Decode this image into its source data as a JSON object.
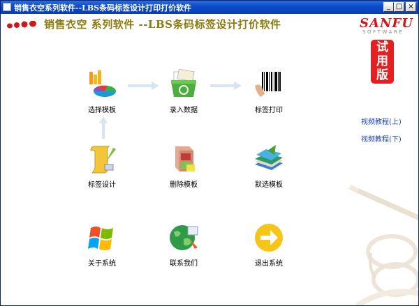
{
  "window": {
    "title": "销售衣空系列软件--LBS条码标签设计打印打价软件",
    "buttons": {
      "min": "_",
      "max": "□",
      "close": "×"
    }
  },
  "header": {
    "heading": "销售衣空 系列软件 --LBS条码标签设计打价软件"
  },
  "logo": {
    "brand": "SANFU",
    "sub": "SOFTWARE"
  },
  "trial_badge": {
    "line1": "试",
    "line2": "用",
    "line3": "版"
  },
  "links": {
    "tutorial_up": "视频教程(上)",
    "tutorial_down": "视频教程(下)"
  },
  "tiles": {
    "select_template": "选择模板",
    "enter_data": "录入数据",
    "print_labels": "标签打印",
    "design_labels": "标签设计",
    "delete_template": "删除模板",
    "default_template": "默选模板",
    "about": "关于系统",
    "contact": "联系我们",
    "exit": "退出系统"
  },
  "colors": {
    "titlebar": "#0b49c8",
    "heading": "#8a7a10",
    "accent_red": "#e42020",
    "link": "#1a3fbf"
  }
}
